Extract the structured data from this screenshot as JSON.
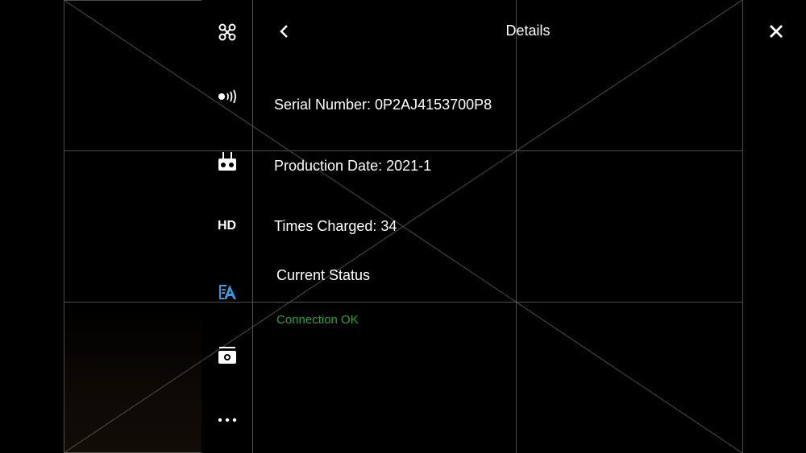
{
  "header": {
    "title": "Details",
    "back_icon": "chevron-left-icon",
    "close_icon": "close-icon"
  },
  "sidebar": {
    "items": [
      {
        "name": "aircraft",
        "icon": "drone-icon"
      },
      {
        "name": "signal",
        "icon": "signal-icon"
      },
      {
        "name": "remote-controller",
        "icon": "remote-controller-icon"
      },
      {
        "name": "hd",
        "label": "HD"
      },
      {
        "name": "battery",
        "icon": "battery-icon",
        "active": true
      },
      {
        "name": "camera",
        "icon": "camera-icon"
      },
      {
        "name": "more",
        "icon": "more-icon"
      }
    ]
  },
  "details": {
    "serial": "Serial Number: 0P2AJ4153700P8",
    "production": "Production Date: 2021-1",
    "charged": "Times Charged: 34",
    "status_heading": "Current Status",
    "status_value": "Connection OK"
  },
  "colors": {
    "accent": "#3a9ad9",
    "ok": "#2ea043"
  }
}
